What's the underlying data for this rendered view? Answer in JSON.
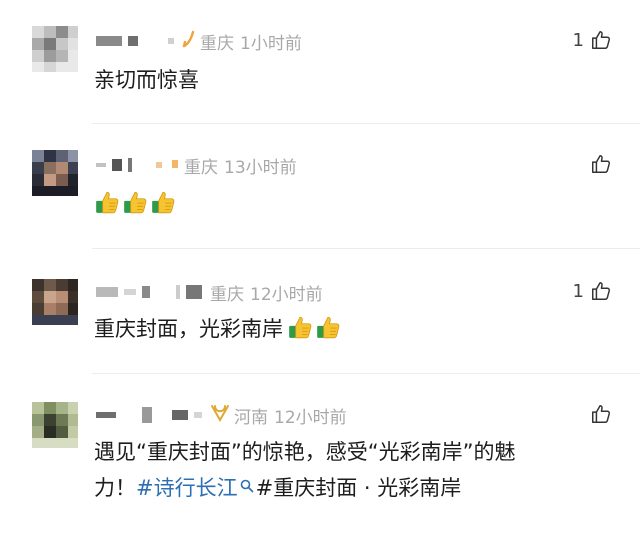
{
  "comments": [
    {
      "location": "重庆",
      "time": "1小时前",
      "likes": "1",
      "text": "亲切而惊喜"
    },
    {
      "location": "重庆",
      "time": "13小时前",
      "likes": "",
      "emoji_count": 3
    },
    {
      "location": "重庆",
      "time": "12小时前",
      "likes": "1",
      "text": "重庆封面，光彩南岸",
      "emoji_count": 2
    },
    {
      "location": "河南",
      "time": "12小时前",
      "likes": "",
      "text_line1": "遇见“重庆封面”的惊艳，感受“光彩南岸”的魅",
      "text_line2_prefix": "力！",
      "hashtag": "#诗行长江",
      "text_line2_suffix": "#重庆封面 · 光彩南岸"
    }
  ],
  "icons": {
    "like": "thumbs-up-outline-icon",
    "emoji": "thumbs-up-emoji",
    "badge_orange": "orange-badge-icon",
    "badge_gold": "gold-badge-icon",
    "search": "search-icon"
  },
  "colors": {
    "meta_gray": "#a8a8a8",
    "hashtag_blue": "#2d6fb3",
    "badge_orange": "#f0a33a"
  }
}
